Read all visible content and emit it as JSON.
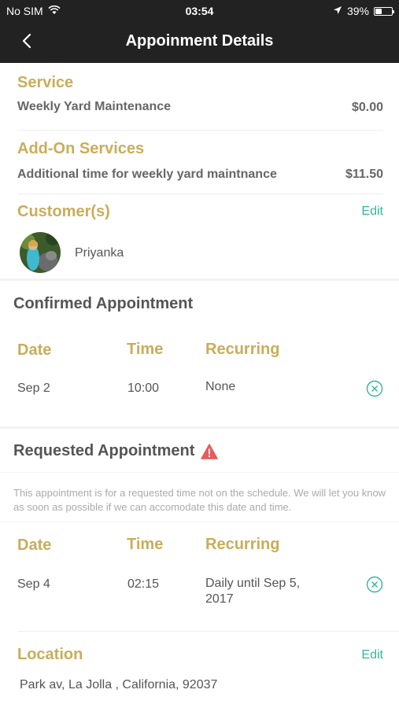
{
  "status_bar": {
    "carrier": "No SIM",
    "time": "03:54",
    "battery_percent": "39%",
    "battery_level": 0.39
  },
  "nav": {
    "title": "Appoinment Details"
  },
  "service": {
    "title": "Service",
    "name": "Weekly Yard Maintenance",
    "price": "$0.00"
  },
  "addons": {
    "title": "Add-On Services",
    "name": "Additional time for weekly yard maintnance",
    "price": "$11.50"
  },
  "customers": {
    "title": "Customer(s)",
    "edit_label": "Edit",
    "list": [
      {
        "name": "Priyanka"
      }
    ]
  },
  "confirmed": {
    "title": "Confirmed Appointment",
    "headers": {
      "date": "Date",
      "time": "Time",
      "recurring": "Recurring"
    },
    "row": {
      "date": "Sep 2",
      "time": "10:00",
      "recurring": "None"
    }
  },
  "requested": {
    "title": "Requested Appointment",
    "note": "This appointment is for a requested time not on the schedule. We will let you know as soon as possible if we can accomodate this date and time.",
    "headers": {
      "date": "Date",
      "time": "Time",
      "recurring": "Recurring"
    },
    "row": {
      "date": "Sep 4",
      "time": "02:15",
      "recurring": "Daily until Sep 5, 2017"
    }
  },
  "location": {
    "title": "Location",
    "edit_label": "Edit",
    "address": "Park av, La Jolla , California, 92037"
  },
  "colors": {
    "accent_gold": "#c9ad5b",
    "accent_teal": "#30b89a",
    "warning_red": "#e85c5c",
    "nav_bg": "#222222"
  }
}
